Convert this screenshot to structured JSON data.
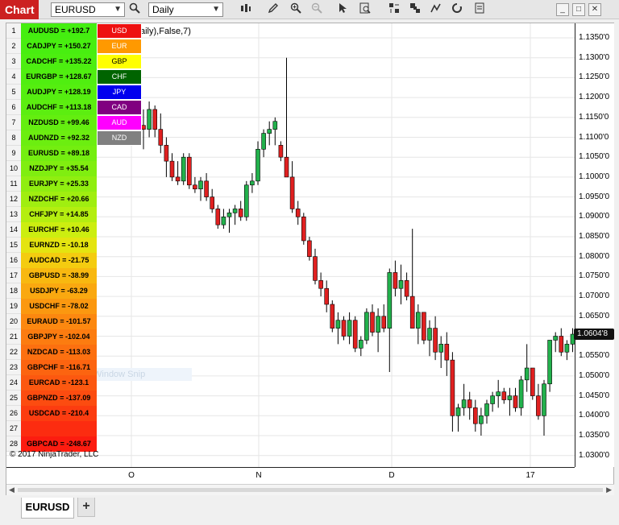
{
  "toolbar": {
    "app_title": "Chart",
    "instrument": "EURUSD",
    "interval": "Daily",
    "icons": [
      "search-icon",
      "bar-type-icon",
      "pencil-icon",
      "zoom-in-icon",
      "zoom-out-icon",
      "pointer-icon",
      "properties-icon",
      "indicators-icon",
      "strategies-icon",
      "drawing-tools-icon",
      "reload-icon",
      "options-icon"
    ]
  },
  "window_controls": {
    "minimize": "_",
    "maximize": "□",
    "close": "✕"
  },
  "chart": {
    "indicator_params": "aily),False,7)",
    "copyright": "© 2017 NinjaTrader, LLC",
    "ghost_text": "Window Snip",
    "price_ticks": [
      "1.1350'0",
      "1.1300'0",
      "1.1250'0",
      "1.1200'0",
      "1.1150'0",
      "1.1100'0",
      "1.1050'0",
      "1.1000'0",
      "1.0950'0",
      "1.0900'0",
      "1.0850'0",
      "1.0800'0",
      "1.0750'0",
      "1.0700'0",
      "1.0650'0",
      "1.0600'0",
      "1.0550'0",
      "1.0500'0",
      "1.0450'0",
      "1.0400'0",
      "1.0350'0",
      "1.0300'0"
    ],
    "last_price": "1.0604'8",
    "time_ticks": [
      "O",
      "N",
      "D",
      "17"
    ],
    "colors": {
      "up": "#22b14c",
      "down": "#e02020",
      "wick": "#000000"
    }
  },
  "chart_data": {
    "type": "candlestick",
    "ylim": [
      1.03,
      1.135
    ],
    "candles": [
      [
        1.113,
        1.117,
        1.107,
        1.112
      ],
      [
        1.112,
        1.119,
        1.11,
        1.117
      ],
      [
        1.117,
        1.118,
        1.11,
        1.112
      ],
      [
        1.112,
        1.116,
        1.106,
        1.108
      ],
      [
        1.108,
        1.11,
        1.1,
        1.104
      ],
      [
        1.104,
        1.106,
        1.099,
        1.1
      ],
      [
        1.1,
        1.104,
        1.098,
        1.099
      ],
      [
        1.099,
        1.106,
        1.098,
        1.105
      ],
      [
        1.105,
        1.106,
        1.097,
        1.098
      ],
      [
        1.098,
        1.1,
        1.096,
        1.097
      ],
      [
        1.097,
        1.1,
        1.094,
        1.099
      ],
      [
        1.099,
        1.101,
        1.094,
        1.095
      ],
      [
        1.095,
        1.097,
        1.091,
        1.092
      ],
      [
        1.092,
        1.093,
        1.087,
        1.088
      ],
      [
        1.088,
        1.092,
        1.087,
        1.09
      ],
      [
        1.09,
        1.092,
        1.086,
        1.091
      ],
      [
        1.091,
        1.093,
        1.088,
        1.092
      ],
      [
        1.092,
        1.094,
        1.089,
        1.09
      ],
      [
        1.09,
        1.099,
        1.089,
        1.098
      ],
      [
        1.098,
        1.101,
        1.096,
        1.099
      ],
      [
        1.099,
        1.109,
        1.098,
        1.107
      ],
      [
        1.107,
        1.112,
        1.105,
        1.111
      ],
      [
        1.111,
        1.114,
        1.108,
        1.112
      ],
      [
        1.112,
        1.115,
        1.108,
        1.114
      ],
      [
        1.108,
        1.109,
        1.104,
        1.105
      ],
      [
        1.105,
        1.13,
        1.102,
        1.1
      ],
      [
        1.1,
        1.104,
        1.091,
        1.092
      ],
      [
        1.092,
        1.094,
        1.088,
        1.09
      ],
      [
        1.09,
        1.091,
        1.083,
        1.084
      ],
      [
        1.084,
        1.085,
        1.079,
        1.08
      ],
      [
        1.08,
        1.082,
        1.073,
        1.074
      ],
      [
        1.074,
        1.076,
        1.07,
        1.072
      ],
      [
        1.072,
        1.074,
        1.066,
        1.068
      ],
      [
        1.068,
        1.069,
        1.061,
        1.062
      ],
      [
        1.062,
        1.066,
        1.058,
        1.064
      ],
      [
        1.064,
        1.065,
        1.059,
        1.06
      ],
      [
        1.06,
        1.066,
        1.058,
        1.064
      ],
      [
        1.064,
        1.065,
        1.056,
        1.057
      ],
      [
        1.057,
        1.06,
        1.055,
        1.059
      ],
      [
        1.059,
        1.067,
        1.058,
        1.066
      ],
      [
        1.066,
        1.068,
        1.06,
        1.061
      ],
      [
        1.061,
        1.067,
        1.056,
        1.065
      ],
      [
        1.065,
        1.068,
        1.061,
        1.062
      ],
      [
        1.062,
        1.077,
        1.051,
        1.076
      ],
      [
        1.076,
        1.079,
        1.07,
        1.072
      ],
      [
        1.072,
        1.078,
        1.068,
        1.074
      ],
      [
        1.074,
        1.076,
        1.069,
        1.07
      ],
      [
        1.07,
        1.087,
        1.064,
        1.062
      ],
      [
        1.062,
        1.068,
        1.058,
        1.066
      ],
      [
        1.066,
        1.066,
        1.058,
        1.059
      ],
      [
        1.059,
        1.064,
        1.055,
        1.062
      ],
      [
        1.062,
        1.065,
        1.054,
        1.056
      ],
      [
        1.056,
        1.06,
        1.052,
        1.058
      ],
      [
        1.058,
        1.061,
        1.05,
        1.054
      ],
      [
        1.054,
        1.056,
        1.036,
        1.04
      ],
      [
        1.04,
        1.043,
        1.036,
        1.042
      ],
      [
        1.042,
        1.048,
        1.04,
        1.044
      ],
      [
        1.044,
        1.046,
        1.039,
        1.042
      ],
      [
        1.042,
        1.044,
        1.036,
        1.038
      ],
      [
        1.038,
        1.042,
        1.035,
        1.04
      ],
      [
        1.04,
        1.044,
        1.038,
        1.043
      ],
      [
        1.043,
        1.046,
        1.041,
        1.045
      ],
      [
        1.045,
        1.049,
        1.042,
        1.046
      ],
      [
        1.046,
        1.047,
        1.043,
        1.044
      ],
      [
        1.044,
        1.047,
        1.04,
        1.045
      ],
      [
        1.045,
        1.047,
        1.041,
        1.042
      ],
      [
        1.042,
        1.05,
        1.04,
        1.049
      ],
      [
        1.049,
        1.058,
        1.046,
        1.052
      ],
      [
        1.052,
        1.052,
        1.044,
        1.045
      ],
      [
        1.045,
        1.048,
        1.039,
        1.04
      ],
      [
        1.04,
        1.049,
        1.035,
        1.048
      ],
      [
        1.048,
        1.059,
        1.046,
        1.059
      ],
      [
        1.059,
        1.061,
        1.056,
        1.06
      ],
      [
        1.06,
        1.062,
        1.055,
        1.056
      ],
      [
        1.056,
        1.059,
        1.054,
        1.058
      ],
      [
        1.058,
        1.062,
        1.056,
        1.0605
      ]
    ]
  },
  "rank_table": [
    {
      "n": "1",
      "pair": "AUDUSD = +192.7",
      "color": "#44ee10"
    },
    {
      "n": "2",
      "pair": "CADJPY = +150.27",
      "color": "#48ee10"
    },
    {
      "n": "3",
      "pair": "CADCHF = +135.22",
      "color": "#4cee10"
    },
    {
      "n": "4",
      "pair": "EURGBP = +128.67",
      "color": "#50ee10"
    },
    {
      "n": "5",
      "pair": "AUDJPY = +128.19",
      "color": "#55ee10"
    },
    {
      "n": "6",
      "pair": "AUDCHF = +113.18",
      "color": "#5cee10"
    },
    {
      "n": "7",
      "pair": "NZDUSD = +99.46",
      "color": "#64ee10"
    },
    {
      "n": "8",
      "pair": "AUDNZD = +92.32",
      "color": "#6cee10"
    },
    {
      "n": "9",
      "pair": "EURUSD = +89.18",
      "color": "#74ee10"
    },
    {
      "n": "10",
      "pair": "NZDJPY = +35.54",
      "color": "#80ee10"
    },
    {
      "n": "11",
      "pair": "EURJPY = +25.33",
      "color": "#90ee10"
    },
    {
      "n": "12",
      "pair": "NZDCHF = +20.66",
      "color": "#a0ee10"
    },
    {
      "n": "13",
      "pair": "CHFJPY = +14.85",
      "color": "#b4ee10"
    },
    {
      "n": "14",
      "pair": "EURCHF = +10.46",
      "color": "#ccee10"
    },
    {
      "n": "15",
      "pair": "EURNZD = -10.18",
      "color": "#e4e410"
    },
    {
      "n": "16",
      "pair": "AUDCAD = -21.75",
      "color": "#f4cc10"
    },
    {
      "n": "17",
      "pair": "GBPUSD = -38.99",
      "color": "#f8b810"
    },
    {
      "n": "18",
      "pair": "USDJPY = -63.29",
      "color": "#faa810"
    },
    {
      "n": "19",
      "pair": "USDCHF = -78.02",
      "color": "#fb9810"
    },
    {
      "n": "20",
      "pair": "EURAUD = -101.57",
      "color": "#fc8810"
    },
    {
      "n": "21",
      "pair": "GBPJPY = -102.04",
      "color": "#fc7c10"
    },
    {
      "n": "22",
      "pair": "NZDCAD = -113.03",
      "color": "#fc7010"
    },
    {
      "n": "23",
      "pair": "GBPCHF = -116.71",
      "color": "#fc6410"
    },
    {
      "n": "24",
      "pair": "EURCAD = -123.1",
      "color": "#fc5810"
    },
    {
      "n": "25",
      "pair": "GBPNZD = -137.09",
      "color": "#fc4c10"
    },
    {
      "n": "26",
      "pair": "USDCAD = -210.4",
      "color": "#fc3c10"
    },
    {
      "n": "27",
      "pair": "",
      "color": "#fc2c10"
    },
    {
      "n": "28",
      "pair": "GBPCAD = -248.67",
      "color": "#fc1c10"
    }
  ],
  "currency_table": [
    {
      "label": "USD",
      "bg": "#ee1111",
      "fg": "#ffffff"
    },
    {
      "label": "EUR",
      "bg": "#ff9900",
      "fg": "#ffffff"
    },
    {
      "label": "GBP",
      "bg": "#ffff00",
      "fg": "#000000"
    },
    {
      "label": "CHF",
      "bg": "#006400",
      "fg": "#ffffff"
    },
    {
      "label": "JPY",
      "bg": "#0000ee",
      "fg": "#ffffff"
    },
    {
      "label": "CAD",
      "bg": "#800080",
      "fg": "#ffffff"
    },
    {
      "label": "AUD",
      "bg": "#ff00ff",
      "fg": "#ffffff"
    },
    {
      "label": "NZD",
      "bg": "#808080",
      "fg": "#ffffff"
    }
  ],
  "tabs": {
    "active": "EURUSD",
    "add": "+"
  }
}
